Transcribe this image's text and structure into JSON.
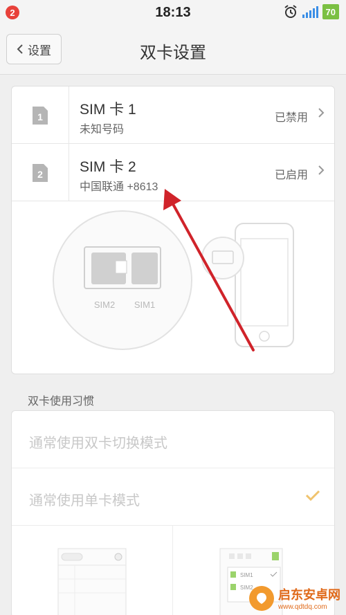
{
  "status_bar": {
    "notification_count": "2",
    "time": "18:13",
    "battery": "70",
    "icons": [
      "alarm-icon",
      "signal-icon",
      "battery-icon"
    ]
  },
  "header": {
    "back_label": "设置",
    "title": "双卡设置"
  },
  "sim_cards": [
    {
      "name": "SIM 卡 1",
      "subtitle": "未知号码",
      "status": "已禁用",
      "slot_badge": "1"
    },
    {
      "name": "SIM 卡 2",
      "subtitle": "中国联通 +8613",
      "status": "已启用",
      "slot_badge": "2"
    }
  ],
  "illustration": {
    "slot_labels": [
      "SIM2",
      "SIM1"
    ]
  },
  "habits": {
    "section_title": "双卡使用习惯",
    "options": [
      {
        "label": "通常使用双卡切换模式",
        "selected": false
      },
      {
        "label": "通常使用单卡模式",
        "selected": true
      }
    ],
    "preview_labels": [
      "SIM1",
      "SIM2"
    ]
  },
  "watermark": {
    "main": "启东安卓网",
    "sub": "www.qdtdq.com"
  },
  "colors": {
    "accent_check": "#f0c36d",
    "annotation_arrow": "#d0232a",
    "notification": "#e8413a",
    "battery": "#7bc043"
  }
}
